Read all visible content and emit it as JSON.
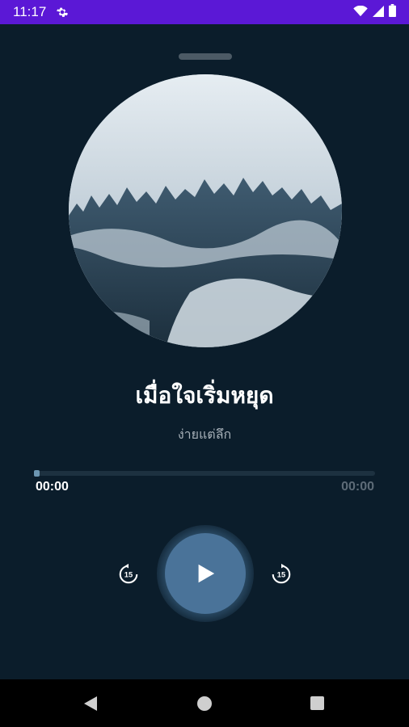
{
  "status_bar": {
    "time": "11:17",
    "background_color": "#5b18d6",
    "icons": [
      "settings-gear-icon",
      "wifi-icon",
      "signal-icon",
      "battery-icon"
    ]
  },
  "player": {
    "background_color": "#0b1d2b",
    "artwork": "misty-forest-image",
    "title": "เมื่อใจเริ่มหยุด",
    "artist": "ง่ายแต่ลึก",
    "progress": 0.0,
    "elapsed_time": "00:00",
    "total_time": "00:00",
    "rewind_seconds": "15",
    "forward_seconds": "15",
    "play_icon": "play-icon",
    "accent_color": "#4a7399"
  },
  "nav_bar": {
    "icons": [
      "back-icon",
      "home-icon",
      "recents-icon"
    ]
  }
}
